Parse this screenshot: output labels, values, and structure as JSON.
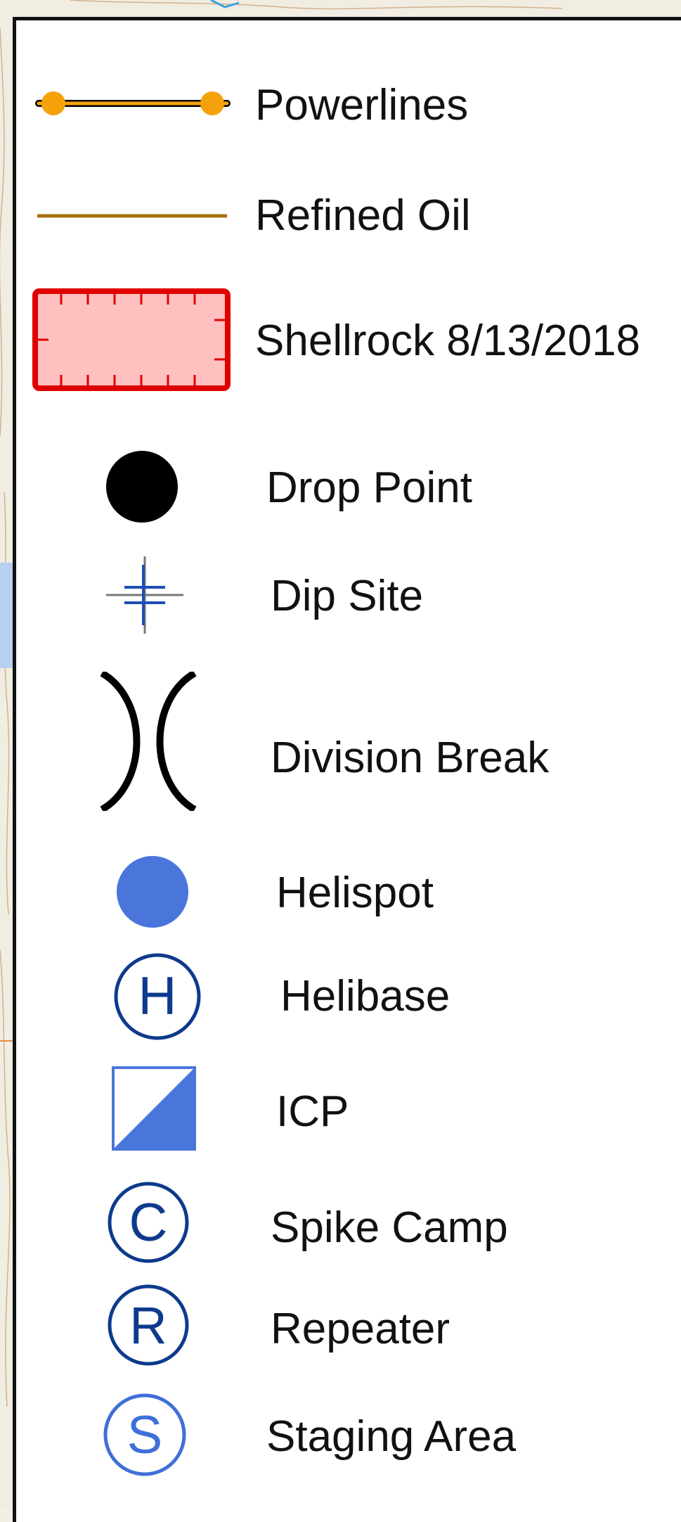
{
  "legend": {
    "items": [
      {
        "label": "Powerlines",
        "symbol": "powerline-symbol",
        "color": "#f5a20a"
      },
      {
        "label": "Refined Oil",
        "symbol": "pipeline-line",
        "color": "#a87012"
      },
      {
        "label": "Shellrock 8/13/2018",
        "symbol": "fire-perimeter-polygon",
        "color": "#e00000",
        "fill": "#ffc0c0"
      },
      {
        "label": "Drop Point",
        "symbol": "black-dot",
        "color": "#000000"
      },
      {
        "label": "Dip Site",
        "symbol": "dip-site-symbol",
        "color": "#1f4fb5"
      },
      {
        "label": "Division Break",
        "symbol": "division-break-symbol",
        "color": "#000000"
      },
      {
        "label": "Helispot",
        "symbol": "blue-dot",
        "color": "#4a76dc"
      },
      {
        "label": "Helibase",
        "symbol": "circled-h",
        "letter": "H",
        "color": "#0d3a8c"
      },
      {
        "label": "ICP",
        "symbol": "half-filled-square",
        "color": "#4a76dc"
      },
      {
        "label": "Spike Camp",
        "symbol": "circled-c",
        "letter": "C",
        "color": "#0d3a8c"
      },
      {
        "label": "Repeater",
        "symbol": "circled-r",
        "letter": "R",
        "color": "#0d3a8c"
      },
      {
        "label": "Staging Area",
        "symbol": "circled-s",
        "letter": "S",
        "color": "#3f6fd8"
      }
    ]
  }
}
